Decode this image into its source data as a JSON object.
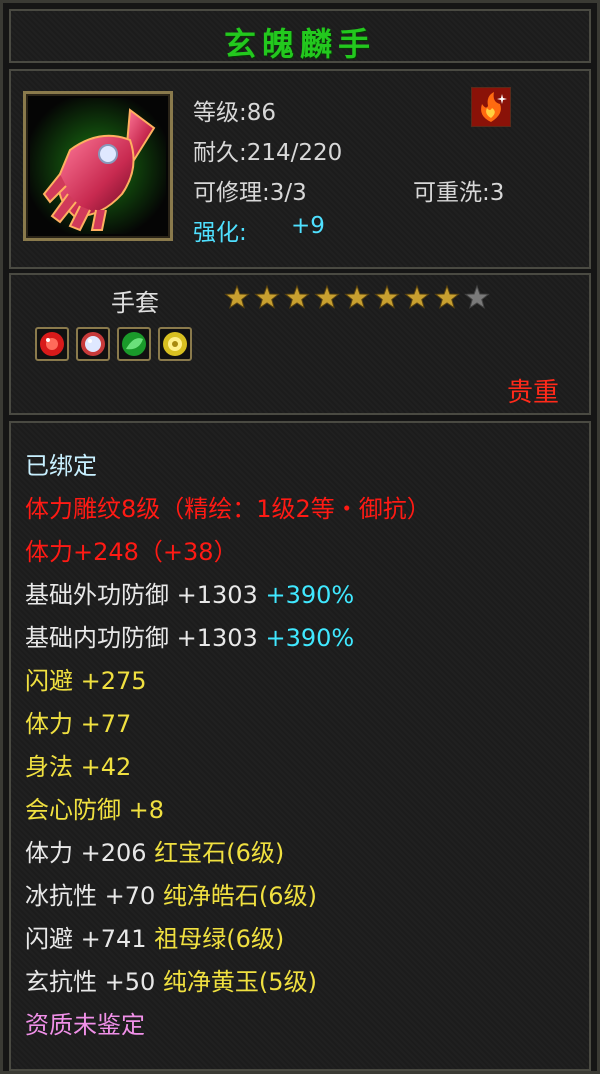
{
  "title": "玄魄麟手",
  "item": {
    "level_label": "等级:86",
    "durability_label": "耐久:214/220",
    "repair_label": "可修理:3/3",
    "rewash_label": "可重洗:3",
    "enhance_label": "强化:",
    "enhance_value": "+9",
    "icon": "red-gauntlet-icon",
    "badge_icon": "flame-sparkle-icon"
  },
  "type": {
    "label": "手套",
    "stars_total": 9,
    "stars_filled": 8,
    "gems": [
      "ruby-gem-icon",
      "crystal-gem-icon",
      "emerald-gem-icon",
      "jade-gem-icon"
    ],
    "quality": "贵重"
  },
  "attributes": {
    "bound": "已绑定",
    "carving": "体力雕纹8级（精绘：1级2等・御抗）",
    "stamina_main": "体力+248（+38）",
    "ext_def_label": "基础外功防御",
    "ext_def_value": "+1303",
    "ext_def_pct": "+390%",
    "int_def_label": "基础内功防御",
    "int_def_value": "+1303",
    "int_def_pct": "+390%",
    "dodge_label": "闪避",
    "dodge_value": "+275",
    "stamina_label": "体力",
    "stamina_value": "+77",
    "agility_label": "身法",
    "agility_value": "+42",
    "crit_def_label": "会心防御",
    "crit_def_value": "+8",
    "gem1_label": "体力",
    "gem1_value": "+206",
    "gem1_name": "红宝石(6级)",
    "gem2_label": "冰抗性",
    "gem2_value": "+70",
    "gem2_name": "纯净皓石(6级)",
    "gem3_label": "闪避",
    "gem3_value": "+741",
    "gem3_name": "祖母绿(6级)",
    "gem4_label": "玄抗性",
    "gem4_value": "+50",
    "gem4_name": "纯净黄玉(5级)",
    "aptitude": "资质未鉴定"
  },
  "colors": {
    "title": "#23c81e",
    "enhance": "#4fe0ff",
    "quality": "#ff2a1a",
    "carving": "#ff1a14",
    "bonus_attr": "#f0e040",
    "gem_name": "#f0e040",
    "percent": "#40e8ff",
    "aptitude": "#f090e8"
  }
}
